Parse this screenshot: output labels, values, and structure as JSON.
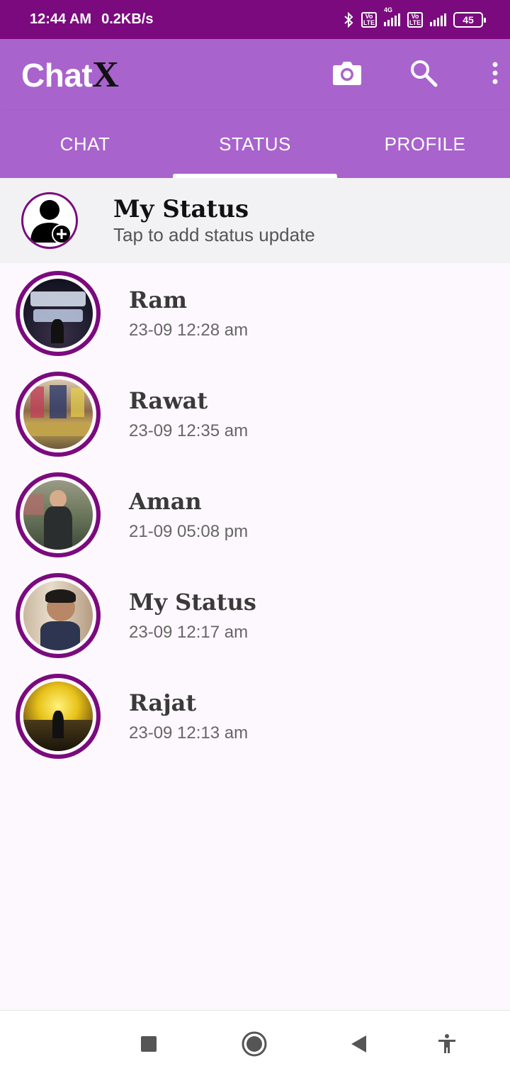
{
  "status_bar": {
    "time": "12:44 AM",
    "speed": "0.2KB/s",
    "volte1": "Vo LTE",
    "network": "4G",
    "volte2": "Vo LTE",
    "battery": "45"
  },
  "app_bar": {
    "title_main": "Chat",
    "title_accent": "X"
  },
  "tabs": [
    {
      "label": "CHAT",
      "active": false
    },
    {
      "label": "STATUS",
      "active": true
    },
    {
      "label": "PROFILE",
      "active": false
    }
  ],
  "my_status": {
    "name": "My Status",
    "subtitle": "Tap to add status update"
  },
  "statuses": [
    {
      "name": "Ram",
      "time": "23-09 12:28 am"
    },
    {
      "name": "Rawat",
      "time": "23-09 12:35 am"
    },
    {
      "name": "Aman",
      "time": "21-09 05:08 pm"
    },
    {
      "name": "My Status",
      "time": "23-09 12:17 am"
    },
    {
      "name": "Rajat",
      "time": "23-09 12:13 am"
    }
  ],
  "colors": {
    "status_bar": "#7b0a7e",
    "app_bar": "#a963cc",
    "ring": "#7b0a7e",
    "background": "#fdf8fd"
  },
  "icons": {
    "camera": "camera-icon",
    "search": "search-icon",
    "more": "more-vert-icon",
    "nav_recents": "square-icon",
    "nav_home": "circle-icon",
    "nav_back": "triangle-back-icon",
    "nav_accessibility": "accessibility-icon"
  }
}
